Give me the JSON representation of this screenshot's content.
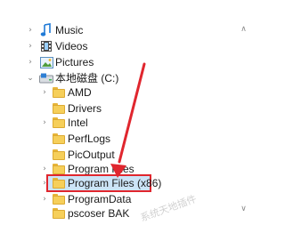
{
  "tree": {
    "items": [
      {
        "label": "Music",
        "icon": "music-note-icon",
        "chevron": "›",
        "level": 1
      },
      {
        "label": "Videos",
        "icon": "videos-icon",
        "chevron": "›",
        "level": 1
      },
      {
        "label": "Pictures",
        "icon": "pictures-icon",
        "chevron": "›",
        "level": 1
      },
      {
        "label": "本地磁盘 (C:)",
        "icon": "local-disk-icon",
        "chevron": "⌄",
        "level": 1
      },
      {
        "label": "AMD",
        "icon": "folder-icon",
        "chevron": "›",
        "level": 2
      },
      {
        "label": "Drivers",
        "icon": "folder-icon",
        "chevron": "",
        "level": 2
      },
      {
        "label": "Intel",
        "icon": "folder-icon",
        "chevron": "›",
        "level": 2
      },
      {
        "label": "PerfLogs",
        "icon": "folder-icon",
        "chevron": "",
        "level": 2
      },
      {
        "label": "PicOutput",
        "icon": "folder-icon",
        "chevron": "",
        "level": 2
      },
      {
        "label": "Program Files",
        "icon": "folder-icon",
        "chevron": "›",
        "level": 2
      },
      {
        "label": "Program Files (x86)",
        "icon": "folder-icon",
        "chevron": "›",
        "level": 2,
        "selected": true
      },
      {
        "label": "ProgramData",
        "icon": "folder-icon",
        "chevron": "›",
        "level": 2
      },
      {
        "label": "pscoser BAK",
        "icon": "folder-icon",
        "chevron": "",
        "level": 2
      }
    ]
  },
  "colors": {
    "selection_bg": "#cce4f7",
    "highlight_border": "#e0262e",
    "arrow": "#e0262e",
    "folder": "#f6cf5a"
  },
  "scrollbar": {
    "up_arrow": "∧",
    "down_arrow": "∨"
  },
  "watermark": "系统天地插件"
}
